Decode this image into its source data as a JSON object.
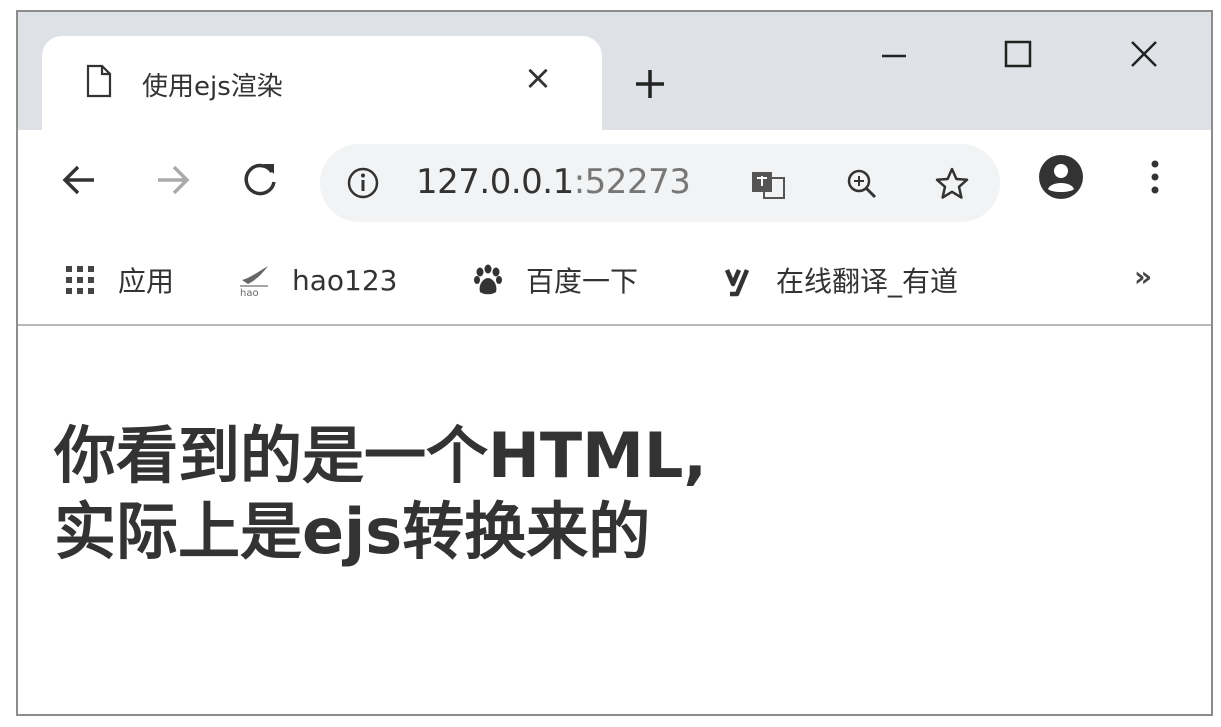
{
  "tab": {
    "title": "使用ejs渲染",
    "close": "×"
  },
  "address_bar": {
    "host": "127.0.0.1",
    "port": ":52273"
  },
  "bookmarks": [
    {
      "label": "应用",
      "icon": "apps-grid-icon"
    },
    {
      "label": "hao123",
      "icon": "hao123-icon"
    },
    {
      "label": "百度一下",
      "icon": "baidu-paw-icon"
    },
    {
      "label": "在线翻译_有道",
      "icon": "youdao-icon"
    }
  ],
  "bookmarks_more": "»",
  "page": {
    "heading_line1": "你看到的是一个HTML,",
    "heading_line2": "实际上是ejs转换来的"
  },
  "colors": {
    "tabstrip": "#dee1e6",
    "omnibox": "#f1f3f4",
    "text": "#333333"
  }
}
